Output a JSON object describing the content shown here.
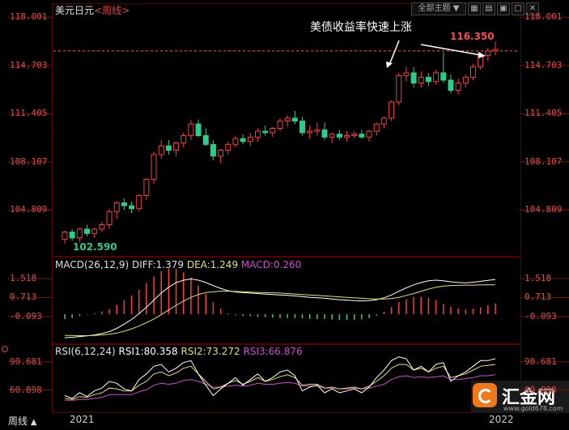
{
  "header": {
    "symbol": "美元日元",
    "period": "<周线>",
    "theme_label": "全部主题",
    "dropdown_glyph": "▼"
  },
  "annotation": {
    "text": "美债收益率快速上涨",
    "max_label": "116.350",
    "min_label": "102.590"
  },
  "macd_header": {
    "title": "MACD(26,12,9)",
    "diff": "DIFF:1.379",
    "dea": "DEA:1.249",
    "macd": "MACD:0.260"
  },
  "rsi_header": {
    "title": "RSI(6,12,24)",
    "rsi1": "RSI1:80.358",
    "rsi2": "RSI2:73.272",
    "rsi3": "RSI3:66.876"
  },
  "footer": {
    "period_button": "周线",
    "arrow": "▲",
    "year_start": "2021",
    "year_end": "2022"
  },
  "watermark": {
    "brand": "汇金网",
    "url": "www.gold678.com"
  },
  "colors": {
    "up": "#ff3b3b",
    "down": "#2ecc8a",
    "diff": "#ffffff",
    "dea": "#e8e05a",
    "macd_label": "#d04ad0",
    "rsi1": "#ffffff",
    "rsi2": "#e8e05a",
    "rsi3": "#d04ad0",
    "axis_text": "#e04a4a"
  },
  "chart_data": [
    {
      "type": "candlestick",
      "ylim": [
        102.0,
        118.3
      ],
      "yticks": [
        "118.001",
        "114.703",
        "111.405",
        "108.107",
        "104.809"
      ],
      "reference_line": 115.7,
      "candles": [
        [
          102.8,
          103.4,
          102.5,
          103.3
        ],
        [
          103.3,
          103.5,
          102.7,
          102.9
        ],
        [
          102.9,
          103.6,
          102.6,
          103.5
        ],
        [
          103.5,
          103.8,
          103.0,
          103.2
        ],
        [
          103.2,
          103.6,
          102.9,
          103.5
        ],
        [
          103.5,
          104.0,
          103.3,
          103.8
        ],
        [
          103.8,
          104.9,
          103.5,
          104.7
        ],
        [
          104.7,
          105.4,
          104.2,
          105.3
        ],
        [
          105.3,
          105.6,
          104.8,
          105.1
        ],
        [
          105.1,
          105.4,
          104.6,
          104.9
        ],
        [
          104.9,
          105.9,
          104.7,
          105.8
        ],
        [
          105.8,
          107.0,
          105.5,
          106.9
        ],
        [
          106.9,
          108.8,
          106.6,
          108.6
        ],
        [
          108.6,
          109.6,
          108.3,
          109.2
        ],
        [
          109.2,
          109.6,
          108.6,
          108.9
        ],
        [
          108.9,
          109.5,
          108.5,
          109.4
        ],
        [
          109.4,
          110.1,
          109.1,
          109.9
        ],
        [
          109.9,
          111.0,
          109.6,
          110.7
        ],
        [
          110.7,
          111.0,
          109.8,
          109.9
        ],
        [
          109.9,
          110.4,
          109.2,
          109.3
        ],
        [
          109.3,
          109.6,
          108.2,
          108.5
        ],
        [
          108.5,
          109.0,
          108.0,
          108.9
        ],
        [
          108.9,
          109.5,
          108.6,
          109.3
        ],
        [
          109.3,
          109.9,
          109.1,
          109.7
        ],
        [
          109.7,
          110.0,
          109.3,
          109.5
        ],
        [
          109.5,
          110.1,
          109.2,
          109.8
        ],
        [
          109.8,
          110.4,
          109.5,
          110.2
        ],
        [
          110.2,
          110.6,
          109.9,
          110.1
        ],
        [
          110.1,
          110.5,
          109.8,
          110.4
        ],
        [
          110.4,
          111.1,
          110.2,
          110.9
        ],
        [
          110.9,
          111.3,
          110.5,
          111.1
        ],
        [
          111.1,
          111.6,
          110.7,
          110.9
        ],
        [
          110.9,
          111.2,
          109.9,
          110.1
        ],
        [
          110.1,
          110.6,
          109.7,
          110.2
        ],
        [
          110.2,
          110.8,
          109.9,
          110.3
        ],
        [
          110.3,
          110.8,
          109.6,
          109.8
        ],
        [
          109.8,
          110.1,
          109.4,
          110.0
        ],
        [
          110.0,
          110.3,
          109.6,
          109.8
        ],
        [
          109.8,
          110.2,
          109.5,
          109.9
        ],
        [
          109.9,
          110.2,
          109.7,
          110.0
        ],
        [
          110.0,
          110.3,
          109.7,
          109.8
        ],
        [
          109.8,
          110.3,
          109.5,
          110.2
        ],
        [
          110.2,
          110.8,
          109.9,
          110.7
        ],
        [
          110.7,
          111.2,
          110.4,
          111.1
        ],
        [
          111.1,
          112.3,
          110.9,
          112.2
        ],
        [
          112.2,
          114.2,
          112.0,
          114.0
        ],
        [
          114.0,
          114.6,
          113.6,
          114.2
        ],
        [
          114.2,
          114.6,
          113.2,
          113.5
        ],
        [
          113.5,
          114.3,
          113.2,
          113.9
        ],
        [
          113.9,
          114.2,
          113.3,
          113.6
        ],
        [
          113.6,
          114.4,
          113.4,
          114.2
        ],
        [
          114.2,
          115.6,
          113.5,
          113.7
        ],
        [
          113.7,
          114.1,
          112.8,
          113.0
        ],
        [
          113.0,
          113.8,
          112.7,
          113.5
        ],
        [
          113.5,
          114.1,
          113.2,
          113.9
        ],
        [
          113.9,
          114.8,
          113.7,
          114.6
        ],
        [
          114.6,
          115.6,
          114.4,
          115.4
        ],
        [
          115.4,
          115.9,
          115.0,
          115.7
        ],
        [
          115.7,
          116.35,
          115.4,
          115.8
        ]
      ]
    },
    {
      "type": "macd",
      "title": "MACD(26,12,9)",
      "ylim": [
        -1.1,
        2.0
      ],
      "yticks": [
        "1.518",
        "0.713",
        "-0.093"
      ],
      "series": [
        {
          "name": "DIFF",
          "values": [
            -1.0,
            -0.98,
            -0.95,
            -0.92,
            -0.88,
            -0.82,
            -0.74,
            -0.6,
            -0.42,
            -0.22,
            0.02,
            0.3,
            0.6,
            0.9,
            1.15,
            1.35,
            1.45,
            1.5,
            1.45,
            1.35,
            1.22,
            1.1,
            1.0,
            0.95,
            0.92,
            0.9,
            0.88,
            0.86,
            0.84,
            0.82,
            0.8,
            0.78,
            0.75,
            0.72,
            0.7,
            0.68,
            0.65,
            0.62,
            0.6,
            0.58,
            0.57,
            0.58,
            0.62,
            0.7,
            0.82,
            0.98,
            1.12,
            1.25,
            1.35,
            1.42,
            1.45,
            1.42,
            1.38,
            1.35,
            1.34,
            1.36,
            1.4,
            1.44,
            1.48
          ]
        },
        {
          "name": "DEA",
          "values": [
            -0.9,
            -0.9,
            -0.91,
            -0.91,
            -0.9,
            -0.88,
            -0.85,
            -0.8,
            -0.72,
            -0.62,
            -0.5,
            -0.36,
            -0.2,
            -0.02,
            0.18,
            0.38,
            0.56,
            0.72,
            0.84,
            0.92,
            0.96,
            0.98,
            0.98,
            0.97,
            0.96,
            0.94,
            0.93,
            0.92,
            0.91,
            0.9,
            0.88,
            0.86,
            0.84,
            0.82,
            0.8,
            0.78,
            0.76,
            0.74,
            0.72,
            0.7,
            0.68,
            0.66,
            0.65,
            0.65,
            0.67,
            0.72,
            0.8,
            0.88,
            0.98,
            1.07,
            1.15,
            1.2,
            1.22,
            1.23,
            1.24,
            1.24,
            1.25,
            1.25,
            1.25
          ]
        },
        {
          "name": "MACD",
          "values": [
            -0.2,
            -0.16,
            -0.08,
            -0.02,
            0.04,
            0.12,
            0.22,
            0.4,
            0.6,
            0.8,
            1.04,
            1.32,
            1.6,
            1.84,
            1.94,
            1.94,
            1.78,
            1.56,
            1.22,
            0.86,
            0.52,
            0.24,
            0.04,
            -0.04,
            -0.08,
            -0.08,
            -0.1,
            -0.12,
            -0.14,
            -0.16,
            -0.16,
            -0.16,
            -0.18,
            -0.2,
            -0.2,
            -0.2,
            -0.22,
            -0.24,
            -0.24,
            -0.24,
            -0.22,
            -0.16,
            -0.06,
            0.1,
            0.3,
            0.52,
            0.64,
            0.74,
            0.74,
            0.7,
            0.6,
            0.44,
            0.32,
            0.24,
            0.2,
            0.24,
            0.3,
            0.38,
            0.46
          ]
        }
      ]
    },
    {
      "type": "line",
      "title": "RSI(6,12,24)",
      "ylim": [
        40,
        100
      ],
      "yticks": [
        "90.681",
        "60.898"
      ],
      "series": [
        {
          "name": "RSI1",
          "values": [
            55,
            52,
            58,
            54,
            60,
            63,
            70,
            68,
            62,
            60,
            72,
            78,
            86,
            88,
            80,
            84,
            90,
            92,
            78,
            66,
            55,
            62,
            68,
            74,
            66,
            72,
            78,
            70,
            74,
            80,
            82,
            76,
            60,
            64,
            66,
            58,
            62,
            58,
            60,
            62,
            58,
            64,
            74,
            82,
            92,
            96,
            94,
            82,
            86,
            80,
            88,
            90,
            70,
            76,
            80,
            86,
            92,
            92,
            94
          ]
        },
        {
          "name": "RSI2",
          "values": [
            52,
            51,
            54,
            53,
            56,
            58,
            63,
            62,
            60,
            60,
            66,
            70,
            78,
            80,
            76,
            79,
            84,
            86,
            78,
            70,
            62,
            64,
            68,
            71,
            67,
            70,
            74,
            70,
            72,
            75,
            77,
            74,
            66,
            67,
            67,
            63,
            64,
            62,
            63,
            64,
            62,
            65,
            70,
            76,
            84,
            88,
            88,
            82,
            84,
            80,
            84,
            86,
            74,
            76,
            78,
            82,
            86,
            87,
            88
          ]
        },
        {
          "name": "RSI3",
          "values": [
            50,
            50,
            51,
            51,
            52,
            53,
            56,
            56,
            56,
            56,
            59,
            61,
            66,
            68,
            67,
            68,
            71,
            72,
            70,
            67,
            64,
            64,
            65,
            66,
            65,
            66,
            68,
            67,
            67,
            68,
            69,
            68,
            65,
            65,
            65,
            63,
            63,
            62,
            62,
            63,
            62,
            63,
            65,
            67,
            72,
            75,
            76,
            74,
            75,
            74,
            75,
            76,
            72,
            72,
            73,
            74,
            76,
            76,
            77
          ]
        }
      ]
    }
  ]
}
